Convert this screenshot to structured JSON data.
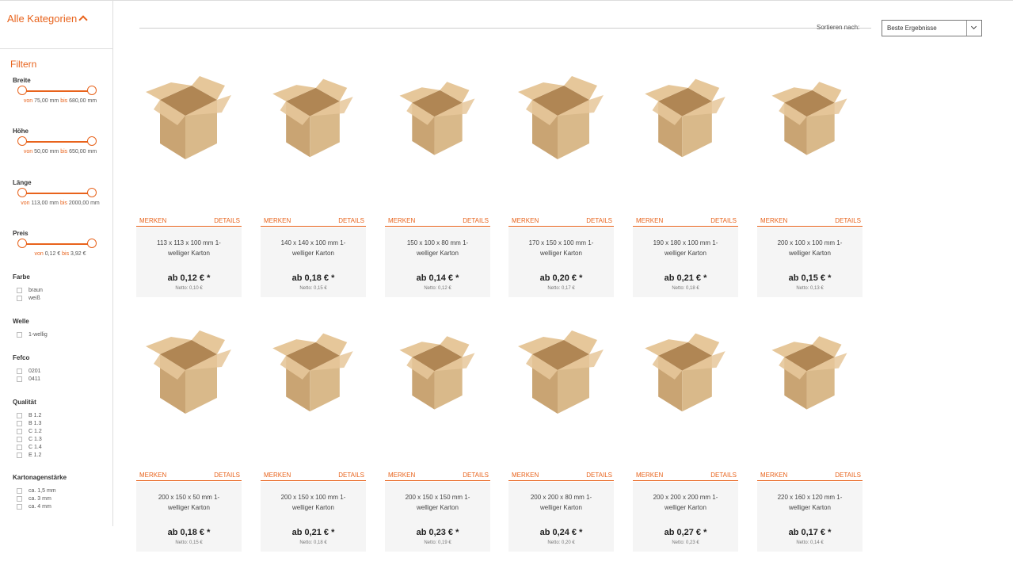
{
  "sidebar": {
    "categories_label": "Alle Kategorien",
    "filter_title": "Filtern",
    "ranges": [
      {
        "label": "Breite",
        "von": "von",
        "from": "75,00 mm",
        "bis": "bis",
        "to": "680,00 mm"
      },
      {
        "label": "Höhe",
        "von": "von",
        "from": "50,00 mm",
        "bis": "bis",
        "to": "650,00 mm"
      },
      {
        "label": "Länge",
        "von": "von",
        "from": "113,00 mm",
        "bis": "bis",
        "to": "2000,00 mm"
      },
      {
        "label": "Preis",
        "von": "von",
        "from": "0,12 €",
        "bis": "bis",
        "to": "3,92 €"
      }
    ],
    "farbe": {
      "label": "Farbe",
      "options": [
        "braun",
        "weiß"
      ]
    },
    "welle": {
      "label": "Welle",
      "options": [
        "1-wellig"
      ]
    },
    "fefco": {
      "label": "Fefco",
      "options": [
        "0201",
        "0411"
      ]
    },
    "qualitaet": {
      "label": "Qualität",
      "options": [
        "B 1.2",
        "B 1.3",
        "C 1.2",
        "C 1.3",
        "C 1.4",
        "E 1.2"
      ]
    },
    "staerke": {
      "label": "Kartonagenstärke",
      "options": [
        "ca. 1,5 mm",
        "ca. 3 mm",
        "ca. 4 mm"
      ]
    }
  },
  "sort": {
    "label": "Sortieren nach:",
    "selected": "Beste Ergebnisse"
  },
  "products": [
    {
      "merken": "MERKEN",
      "details": "DETAILS",
      "name_line1": "113 x 113 x 100 mm 1-",
      "name_line2": "welliger Karton",
      "price": "ab 0,12 € *",
      "net": "Netto: 0,10 €"
    },
    {
      "merken": "MERKEN",
      "details": "DETAILS",
      "name_line1": "140 x 140 x 100 mm 1-",
      "name_line2": "welliger Karton",
      "price": "ab 0,18 € *",
      "net": "Netto: 0,15 €"
    },
    {
      "merken": "MERKEN",
      "details": "DETAILS",
      "name_line1": "150 x 100 x 80 mm 1-",
      "name_line2": "welliger Karton",
      "price": "ab 0,14 € *",
      "net": "Netto: 0,12 €"
    },
    {
      "merken": "MERKEN",
      "details": "DETAILS",
      "name_line1": "170 x 150 x 100 mm 1-",
      "name_line2": "welliger Karton",
      "price": "ab 0,20 € *",
      "net": "Netto: 0,17 €"
    },
    {
      "merken": "MERKEN",
      "details": "DETAILS",
      "name_line1": "190 x 180 x 100 mm 1-",
      "name_line2": "welliger Karton",
      "price": "ab 0,21 € *",
      "net": "Netto: 0,18 €"
    },
    {
      "merken": "MERKEN",
      "details": "DETAILS",
      "name_line1": "200 x 100 x 100 mm 1-",
      "name_line2": "welliger Karton",
      "price": "ab 0,15 € *",
      "net": "Netto: 0,13 €"
    },
    {
      "merken": "MERKEN",
      "details": "DETAILS",
      "name_line1": "200 x 150 x 50 mm 1-",
      "name_line2": "welliger Karton",
      "price": "ab 0,18 € *",
      "net": "Netto: 0,15 €"
    },
    {
      "merken": "MERKEN",
      "details": "DETAILS",
      "name_line1": "200 x 150 x 100 mm 1-",
      "name_line2": "welliger Karton",
      "price": "ab 0,21 € *",
      "net": "Netto: 0,18 €"
    },
    {
      "merken": "MERKEN",
      "details": "DETAILS",
      "name_line1": "200 x 150 x 150 mm 1-",
      "name_line2": "welliger Karton",
      "price": "ab 0,23 € *",
      "net": "Netto: 0,19 €"
    },
    {
      "merken": "MERKEN",
      "details": "DETAILS",
      "name_line1": "200 x 200 x 80 mm 1-",
      "name_line2": "welliger Karton",
      "price": "ab 0,24 € *",
      "net": "Netto: 0,20 €"
    },
    {
      "merken": "MERKEN",
      "details": "DETAILS",
      "name_line1": "200 x 200 x 200 mm 1-",
      "name_line2": "welliger Karton",
      "price": "ab 0,27 € *",
      "net": "Netto: 0,23 €"
    },
    {
      "merken": "MERKEN",
      "details": "DETAILS",
      "name_line1": "220 x 160 x 120 mm 1-",
      "name_line2": "welliger Karton",
      "price": "ab 0,17 € *",
      "net": "Netto: 0,14 €"
    }
  ],
  "colors": {
    "accent": "#e8631c",
    "box_front": "#d9b98a",
    "box_side": "#c9a473",
    "box_inner": "#b08654",
    "box_flap": "#e6c79a"
  },
  "icons": {
    "category_toggle": "chevron-up-icon",
    "sort_toggle": "chevron-down-icon",
    "product_image": "cardboard-box-icon"
  }
}
